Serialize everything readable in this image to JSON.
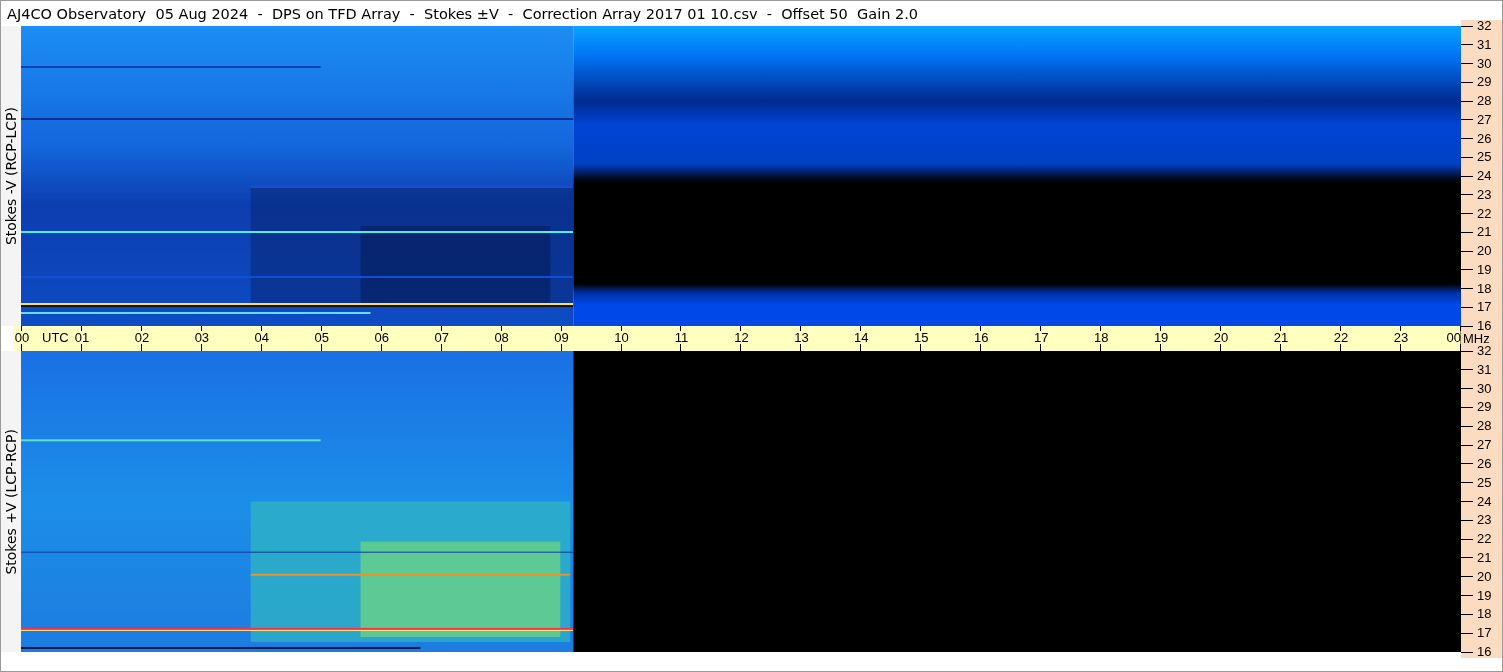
{
  "title": "AJ4CO Observatory  05 Aug 2024  -  DPS on TFD Array  -  Stokes ±V  -  Correction Array 2017 01 10.csv  -  Offset 50  Gain 2.0",
  "panels": [
    {
      "label": "Stokes -V (RCP-LCP)",
      "kind": "minus",
      "freq_ticks": [
        "32",
        "31",
        "30",
        "29",
        "28",
        "27",
        "26",
        "25",
        "24",
        "23",
        "22",
        "21",
        "20",
        "19",
        "18",
        "17",
        "16"
      ]
    },
    {
      "label": "Stokes +V (LCP-RCP)",
      "kind": "plus",
      "freq_ticks": [
        "32",
        "31",
        "30",
        "29",
        "28",
        "27",
        "26",
        "25",
        "24",
        "23",
        "22",
        "21",
        "20",
        "19",
        "18",
        "17",
        "16"
      ]
    }
  ],
  "time_axis": {
    "unit": "UTC",
    "freq_unit": "MHz",
    "ticks": [
      "00",
      "01",
      "02",
      "03",
      "04",
      "05",
      "06",
      "07",
      "08",
      "09",
      "10",
      "11",
      "12",
      "13",
      "14",
      "15",
      "16",
      "17",
      "18",
      "19",
      "20",
      "21",
      "22",
      "23",
      "00"
    ]
  }
}
